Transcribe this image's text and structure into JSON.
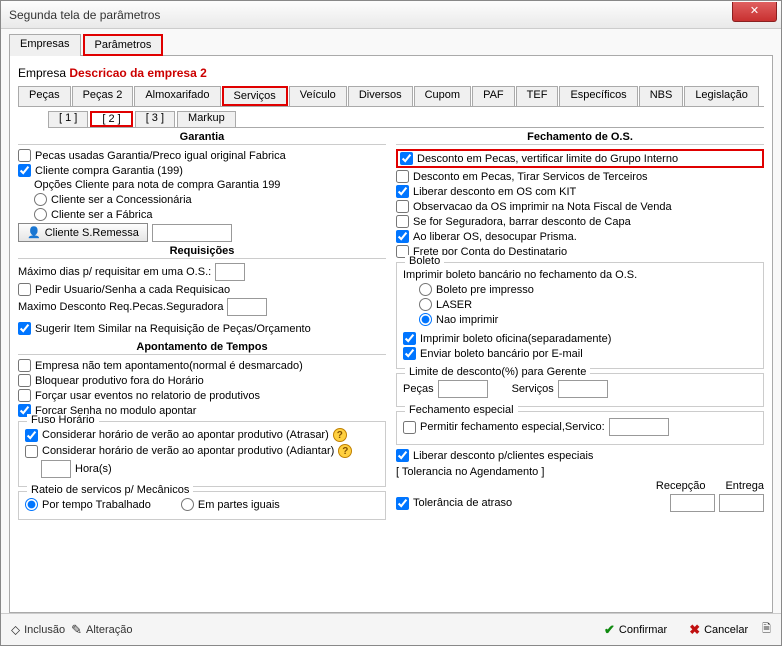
{
  "window": {
    "title": "Segunda tela de parâmetros"
  },
  "topTabs": {
    "empresas": "Empresas",
    "parametros": "Parâmetros"
  },
  "empresa": {
    "label": "Empresa",
    "desc": "Descricao da empresa 2"
  },
  "subTabs": {
    "pecas": "Peças",
    "pecas2": "Peças 2",
    "almox": "Almoxarifado",
    "servicos": "Serviços",
    "veiculo": "Veículo",
    "diversos": "Diversos",
    "cupom": "Cupom",
    "paf": "PAF",
    "tef": "TEF",
    "espec": "Específicos",
    "nbs": "NBS",
    "leg": "Legislação"
  },
  "pageTabs": {
    "p1": "[  1  ]",
    "p2": "[  2  ]",
    "p3": "[  3  ]",
    "markup": "Markup"
  },
  "left": {
    "garantia": {
      "title": "Garantia",
      "chkPecasUsadas": "Pecas usadas Garantia/Preco igual original Fabrica",
      "chkClienteCompra": "Cliente compra Garantia (199)",
      "opcoesLabel": "Opções Cliente para nota de compra Garantia 199",
      "optConcess": "Cliente ser a Concessionária",
      "optFabrica": "Cliente ser a Fábrica",
      "btnRemessa": "Cliente S.Remessa"
    },
    "req": {
      "title": "Requisições",
      "maxDias": "Máximo dias p/ requisitar em uma O.S.:",
      "pedirUsuario": "Pedir Usuario/Senha a cada Requisicao",
      "maxDesc": "Maximo Desconto Req.Pecas.Seguradora",
      "sugerir": "Sugerir Item Similar na Requisição de Peças/Orçamento"
    },
    "apont": {
      "title": "Apontamento de Tempos",
      "empNao": "Empresa não tem apontamento(normal é desmarcado)",
      "bloq": "Bloquear produtivo fora do Horário",
      "forcarEventos": "Forçar usar eventos no relatorio de produtivos",
      "forcarSenha": "Forçar Senha no modulo apontar"
    },
    "fuso": {
      "title": "Fuso Horário",
      "atrasar": "Considerar horário de verão ao apontar produtivo (Atrasar)",
      "adiantar": "Considerar horário de verão ao apontar produtivo (Adiantar)",
      "horas": "Hora(s)"
    },
    "rateio": {
      "title": "Rateio de servicos p/ Mecânicos",
      "tempo": "Por tempo Trabalhado",
      "partes": "Em partes iguais"
    }
  },
  "right": {
    "fech": {
      "title": "Fechamento de O.S.",
      "descGrupo": "Desconto em Pecas, vertificar limite do Grupo Interno",
      "descTerc": "Desconto em Pecas, Tirar Servicos de Terceiros",
      "libKit": "Liberar desconto em OS com KIT",
      "obsNota": "Observacao da OS imprimir na Nota Fiscal de Venda",
      "seguradora": "Se for Seguradora, barrar desconto de Capa",
      "aoLiberar": "Ao liberar OS, desocupar Prisma.",
      "freteDest": "Frete por Conta do Destinatario"
    },
    "boleto": {
      "title": "Boleto",
      "imprLabel": "Imprimir boleto bancário no fechamento da O.S.",
      "pre": "Boleto pre impresso",
      "laser": "LASER",
      "nao": "Nao imprimir",
      "oficina": "Imprimir boleto oficina(separadamente)",
      "email": "Enviar boleto bancário por E-mail"
    },
    "limite": {
      "title": "Limite de desconto(%) para Gerente",
      "pecas": "Peças",
      "serv": "Serviços"
    },
    "especial": {
      "title": "Fechamento especial",
      "permitir": "Permitir fechamento especial,Servico:"
    },
    "liberar": "Liberar desconto p/clientes especiais",
    "tol": {
      "title": "[ Tolerancia no Agendamento ]",
      "atraso": "Tolerância de atraso",
      "recep": "Recepção",
      "entrega": "Entrega"
    }
  },
  "footer": {
    "inclusao": "Inclusão",
    "alteracao": "Alteração",
    "confirmar": "Confirmar",
    "cancelar": "Cancelar"
  }
}
